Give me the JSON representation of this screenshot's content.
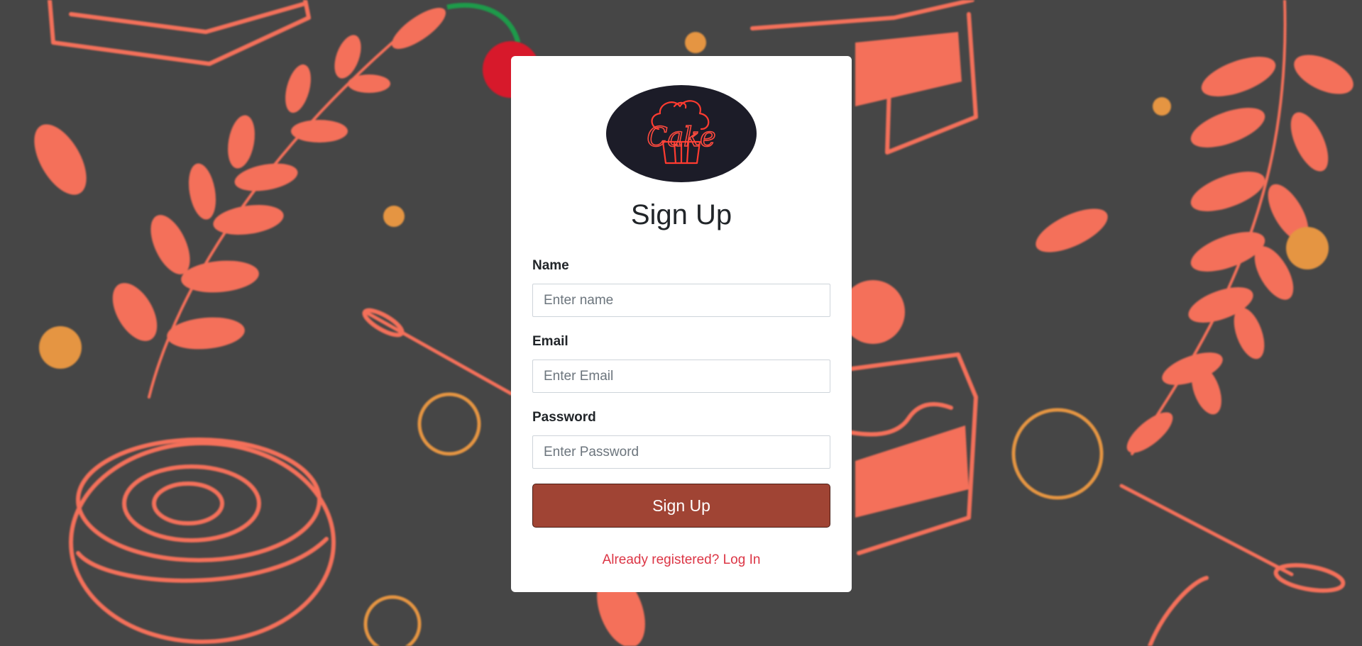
{
  "page": {
    "background_color": "#464646",
    "pattern_color": "#f4705a",
    "accent_color": "#e59542"
  },
  "logo": {
    "text": "Cake",
    "icon": "cupcake-neon-logo",
    "neon_color": "#ff3b30"
  },
  "form": {
    "title": "Sign Up",
    "fields": [
      {
        "label": "Name",
        "placeholder": "Enter name",
        "value": ""
      },
      {
        "label": "Email",
        "placeholder": "Enter Email",
        "value": ""
      },
      {
        "label": "Password",
        "placeholder": "Enter Password",
        "value": ""
      }
    ],
    "submit_label": "Sign Up",
    "submit_color": "#a04434",
    "login_link": "Already registered? Log In",
    "login_link_color": "#dc3545"
  }
}
